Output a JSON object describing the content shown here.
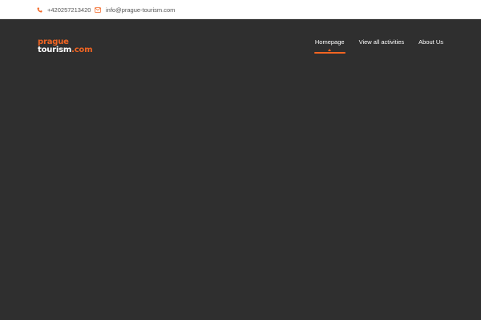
{
  "topbar": {
    "phone": "+420257213420",
    "email": "info@prague-tourism.com"
  },
  "brand": {
    "line1": "prague",
    "line2_main": "tourism",
    "line2_tld": ".com",
    "colors": {
      "accent": "#f26522",
      "text": "#ffffff"
    }
  },
  "nav": {
    "items": [
      {
        "label": "Homepage",
        "active": true
      },
      {
        "label": "View all activities",
        "active": false
      },
      {
        "label": "About Us",
        "active": false
      }
    ]
  },
  "icons": {
    "phone": "phone-icon",
    "email": "envelope-icon"
  },
  "colors": {
    "header_bg": "#2f2f2f",
    "topbar_bg": "#ffffff"
  }
}
